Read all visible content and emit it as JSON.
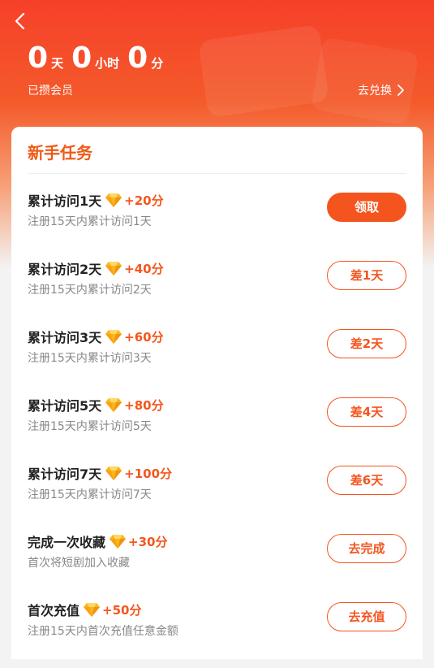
{
  "header": {
    "days": "0",
    "days_unit": "天",
    "hours": "0",
    "hours_unit": "小时",
    "minutes": "0",
    "minutes_unit": "分",
    "subtitle": "已攒会员",
    "redeem_label": "去兑换"
  },
  "card": {
    "title": "新手任务",
    "tasks": [
      {
        "title": "累计访问1天",
        "points": "+20分",
        "desc": "注册15天内累计访问1天",
        "button": "领取",
        "button_style": "solid"
      },
      {
        "title": "累计访问2天",
        "points": "+40分",
        "desc": "注册15天内累计访问2天",
        "button": "差1天",
        "button_style": "outline"
      },
      {
        "title": "累计访问3天",
        "points": "+60分",
        "desc": "注册15天内累计访问3天",
        "button": "差2天",
        "button_style": "outline"
      },
      {
        "title": "累计访问5天",
        "points": "+80分",
        "desc": "注册15天内累计访问5天",
        "button": "差4天",
        "button_style": "outline"
      },
      {
        "title": "累计访问7天",
        "points": "+100分",
        "desc": "注册15天内累计访问7天",
        "button": "差6天",
        "button_style": "outline"
      },
      {
        "title": "完成一次收藏",
        "points": "+30分",
        "desc": "首次将短剧加入收藏",
        "button": "去完成",
        "button_style": "outline"
      },
      {
        "title": "首次充值",
        "points": "+50分",
        "desc": "注册15天内首次充值任意金额",
        "button": "去充值",
        "button_style": "outline"
      }
    ]
  },
  "colors": {
    "accent": "#f4551f",
    "title_orange": "#ee5a16",
    "header_red": "#f6402a"
  },
  "icons": {
    "back": "chevron-left-icon",
    "redeem_arrow": "chevron-right-icon",
    "points": "diamond-icon"
  }
}
